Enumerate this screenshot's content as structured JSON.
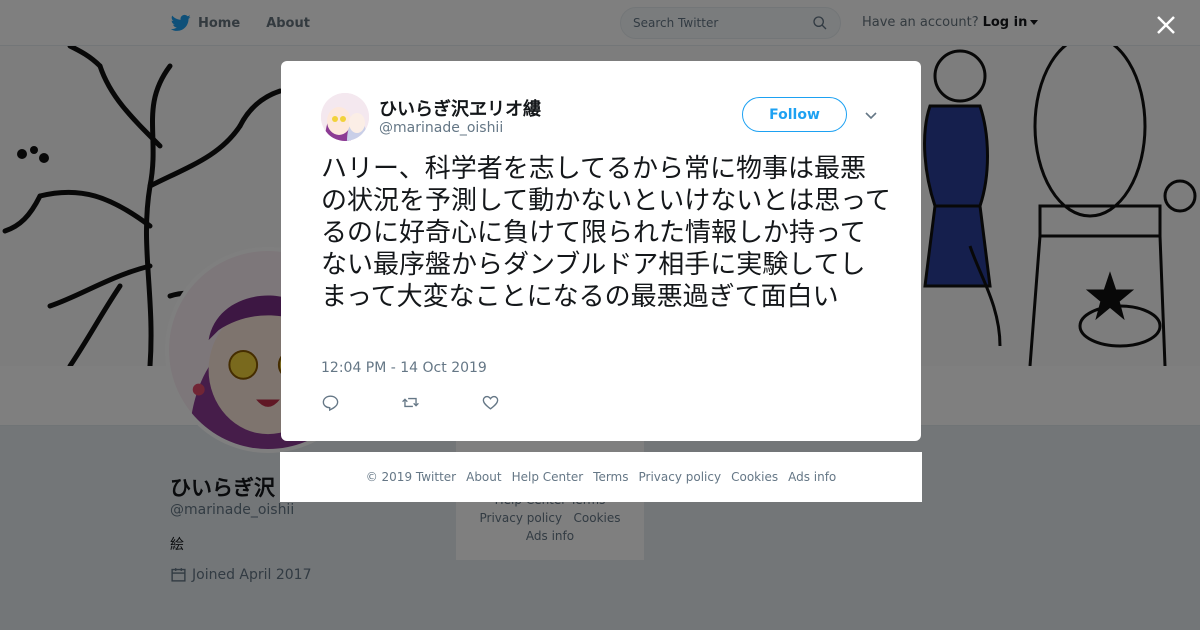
{
  "topnav": {
    "home": "Home",
    "about": "About",
    "search_placeholder": "Search Twitter",
    "have_account": "Have an account?",
    "login": "Log in"
  },
  "profile": {
    "name": "ひいらぎ沢",
    "handle": "@marinade_oishii",
    "bio": "絵",
    "joined": "Joined April 2017"
  },
  "bg_footer": {
    "row1": "Help Center   Terms",
    "row2_a": "Privacy policy",
    "row2_b": "Cookies",
    "row3": "Ads info"
  },
  "tweet": {
    "author_name": "ひいらぎ沢ヱリオ縷",
    "author_handle": "@marinade_oishii",
    "follow_label": "Follow",
    "text": "ハリー、科学者を志してるから常に物事は最悪の状況を予測して動かないといけないとは思ってるのに好奇心に負けて限られた情報しか持ってない最序盤からダンブルドア相手に実験してしまって大変なことになるの最悪過ぎて面白い",
    "timestamp": "12:04 PM - 14 Oct 2019"
  },
  "footer": {
    "copyright": "© 2019 Twitter",
    "about": "About",
    "help": "Help Center",
    "terms": "Terms",
    "privacy": "Privacy policy",
    "cookies": "Cookies",
    "ads": "Ads info"
  },
  "colors": {
    "accent": "#1da1f2",
    "overlay": "rgba(0,0,0,0.5)",
    "muted": "#657786"
  }
}
